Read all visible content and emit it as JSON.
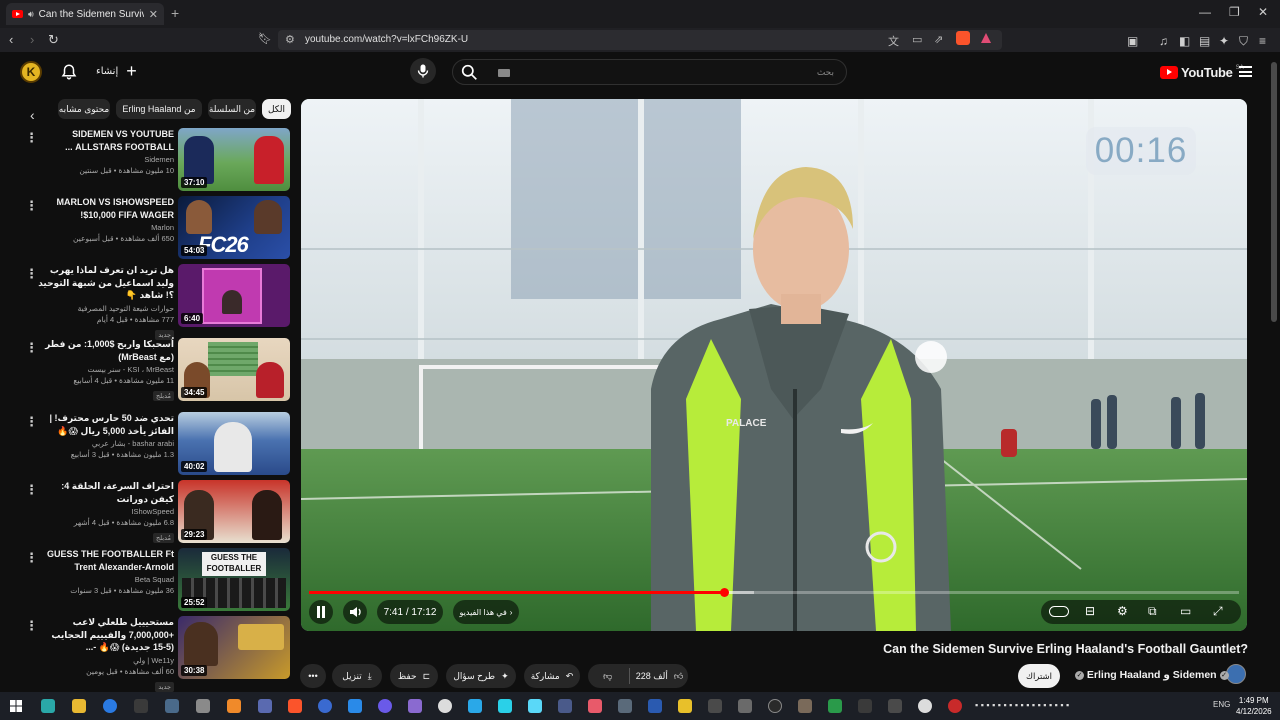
{
  "browser": {
    "tab_title": "Can the Sidemen Survive Erli",
    "url": "youtube.com/watch?v=lxFCh96ZK-U"
  },
  "header": {
    "create_label": "إنشاء",
    "search_placeholder": "بحث",
    "logo_text": "YouTube",
    "logo_region": "SA",
    "avatar_letter": "K"
  },
  "chips": [
    {
      "label": "الكل",
      "active": true
    },
    {
      "label": "من السلسلة",
      "active": false
    },
    {
      "label": "Erling Haaland من",
      "active": false
    },
    {
      "label": "محتوى مشابه",
      "active": false
    }
  ],
  "sidebar": {
    "videos": [
      {
        "title": "SIDEMEN VS YOUTUBE ALLSTARS FOOTBALL ...",
        "channel": "Sidemen",
        "views": "10 مليون مشاهدة • قبل سنتين",
        "duration": "37:10",
        "badge": ""
      },
      {
        "title": "MARLON VS ISHOWSPEED $10,000 FIFA WAGER!",
        "channel": "Marlon",
        "views": "650 ألف مشاهدة • قبل أسبوعين",
        "duration": "54:03",
        "badge": ""
      },
      {
        "title": "هل تريد ان تعرف لماذا يهرب وليد اسماعيل من شبهة التوحيد ؟! شاهد 👇",
        "channel": "حوارات شيعة التوحيد المصرفية",
        "views": "777 مشاهدة • قبل 4 أيام",
        "duration": "6:40",
        "badge": "جديد"
      },
      {
        "title": "اُسحبكا واربح $1,000: من فطر (مع MrBeast)",
        "channel": "KSI ، MrBeast - سنر بيست",
        "views": "11 مليون مشاهدة • قبل 4 أسابيع",
        "duration": "34:45",
        "badge": "مُدبلج"
      },
      {
        "title": "تحدي ضد 50 حارس محترف! | الفائز يأخذ 5,000 ريال 😱🔥",
        "channel": "bashar arabi - بشار عربي",
        "views": "1.3 مليون مشاهدة • قبل 3 أسابيع",
        "duration": "40:02",
        "badge": ""
      },
      {
        "title": "احتراف السرعة، الحلقة 4: كيفن دورانت",
        "channel": "IShowSpeed",
        "views": "6.8 مليون مشاهدة • قبل 4 أشهر",
        "duration": "29:23",
        "badge": "مُدبلج"
      },
      {
        "title": "GUESS THE FOOTBALLER Ft Trent Alexander-Arnold",
        "channel": "Beta Squad",
        "views": "36 مليون مشاهدة • قبل 3 سنوات",
        "duration": "25:52",
        "badge": ""
      },
      {
        "title": "مستحيييل طلعلي لاعب +7,000,000 والفيييم الحجايب (5-15 جديدة) 😱🔥 -...",
        "channel": "We11y | ولي",
        "views": "60 ألف مشاهدة • قبل يومين",
        "duration": "30:38",
        "badge": "جديد"
      }
    ]
  },
  "player": {
    "overlay_timer": "00:16",
    "time_display": "7:41 / 17:12",
    "chapter_label": "في هذا الفيديو",
    "progress": 0.447,
    "buffered": 0.478
  },
  "video": {
    "title": "Can the Sidemen Survive Erling Haaland's Football Gauntlet?",
    "owners": "Erling Haaland و Sidemen",
    "subscribe_label": "اشتراك",
    "like_count": "228 ألف",
    "share_label": "مشاركة",
    "ask_label": "طرح سؤال",
    "save_label": "حفظ",
    "download_label": "تنزيل"
  },
  "taskbar": {
    "time": "1:49 PM",
    "date": "4/12/2026",
    "lang": "ENG"
  },
  "colors": {
    "accent": "#ff0000",
    "background": "#0f0f0f",
    "chip": "#272727"
  }
}
